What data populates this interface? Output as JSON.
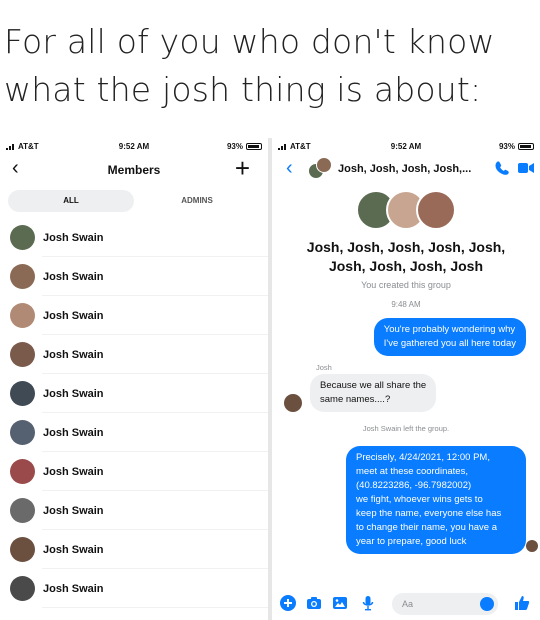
{
  "caption": {
    "line1": "For all of you who don't know",
    "line2": "what the josh thing is about:"
  },
  "left": {
    "status": {
      "carrier": "AT&T",
      "time": "9:52 AM",
      "battery": "93%"
    },
    "title": "Members",
    "tabs": [
      "ALL",
      "ADMINS"
    ],
    "members": [
      {
        "name": "Josh Swain",
        "color": "#5b6b52"
      },
      {
        "name": "Josh Swain",
        "color": "#8a6a55"
      },
      {
        "name": "Josh Swain",
        "color": "#b08a74"
      },
      {
        "name": "Josh Swain",
        "color": "#7a5a4a"
      },
      {
        "name": "Josh Swain",
        "color": "#3f4a55"
      },
      {
        "name": "Josh Swain",
        "color": "#556070"
      },
      {
        "name": "Josh Swain",
        "color": "#9a4a4a"
      },
      {
        "name": "Josh Swain",
        "color": "#6a6a6a"
      },
      {
        "name": "Josh Swain",
        "color": "#6b5040"
      },
      {
        "name": "Josh Swain",
        "color": "#4a4a4a"
      }
    ]
  },
  "right": {
    "status": {
      "carrier": "AT&T",
      "time": "9:52 AM",
      "battery": "93%"
    },
    "chat_title": "Josh, Josh, Josh, Josh,...",
    "group_name_line1": "Josh, Josh, Josh, Josh, Josh,",
    "group_name_line2": "Josh, Josh, Josh, Josh",
    "group_sub": "You created this group",
    "timestamp": "9:48 AM",
    "messages": {
      "m1_line1": "You're probably wondering why",
      "m1_line2": "I've gathered you all here today",
      "sender": "Josh",
      "m2_line1": "Because we all share the",
      "m2_line2": "same names....?",
      "system": "Josh Swain left the group.",
      "m3_lines": [
        "Precisely, 4/24/2021, 12:00 PM,",
        "meet at these coordinates,",
        "(40.8223286, -96.7982002)",
        "we fight, whoever wins gets to",
        "keep the name, everyone else has",
        "to change their name, you have a",
        "year to prepare, good luck"
      ]
    },
    "composer_placeholder": "Aa",
    "accent": "#0a7cff"
  }
}
